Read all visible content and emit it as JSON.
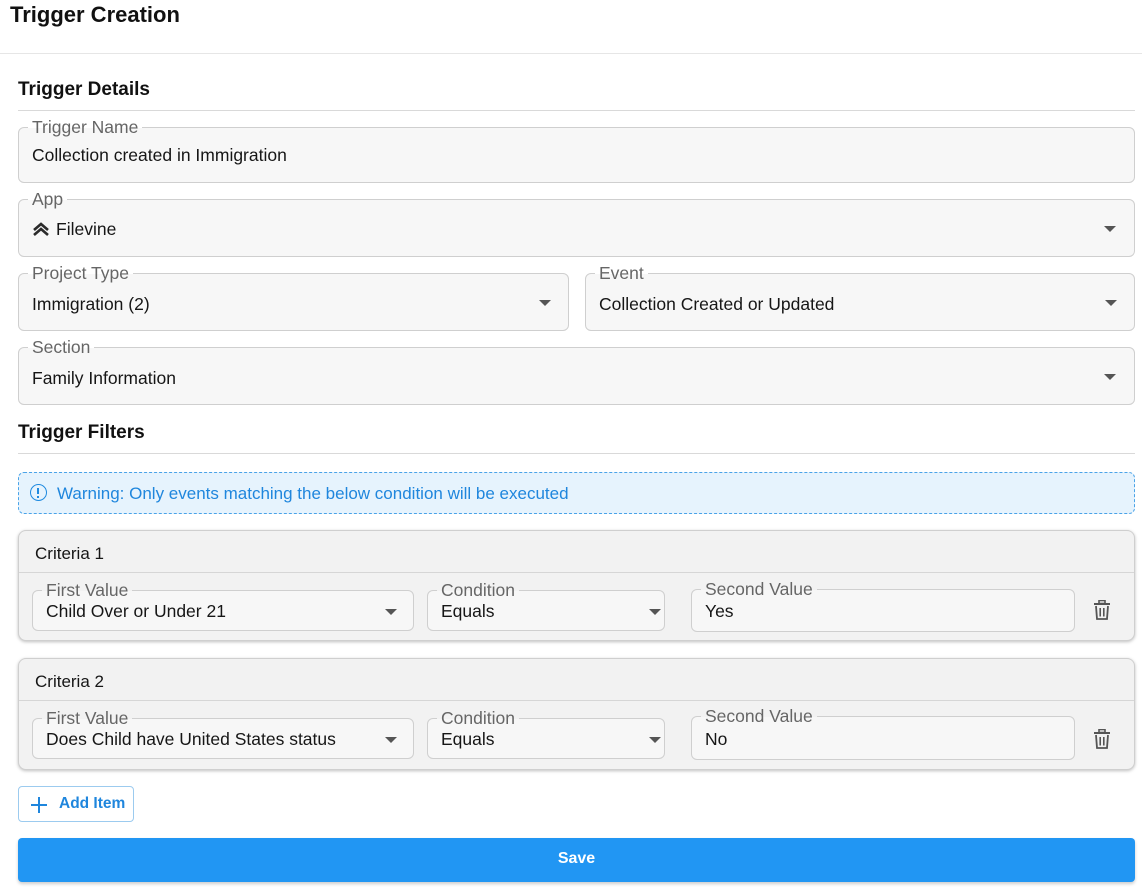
{
  "header": {
    "title": "Trigger Creation"
  },
  "details": {
    "title": "Trigger Details",
    "trigger_name": {
      "label": "Trigger Name",
      "value": "Collection created in Immigration"
    },
    "app": {
      "label": "App",
      "value": "Filevine",
      "icon": "filevine-logo-icon"
    },
    "project_type": {
      "label": "Project Type",
      "value": "Immigration (2)"
    },
    "event": {
      "label": "Event",
      "value": "Collection Created or Updated"
    },
    "section": {
      "label": "Section",
      "value": "Family Information"
    }
  },
  "filters": {
    "title": "Trigger Filters",
    "warning": {
      "text": "Warning: Only events matching the below condition will be executed",
      "icon": "info-icon",
      "color": "#1f86dd"
    },
    "criteria": [
      {
        "title": "Criteria 1",
        "first_value_label": "First Value",
        "first_value": "Child Over or Under 21",
        "condition_label": "Condition",
        "condition": "Equals",
        "second_value_label": "Second Value",
        "second_value": "Yes"
      },
      {
        "title": "Criteria 2",
        "first_value_label": "First Value",
        "first_value": "Does Child have United States status",
        "condition_label": "Condition",
        "condition": "Equals",
        "second_value_label": "Second Value",
        "second_value": "No"
      }
    ]
  },
  "actions": {
    "add_item_label": "Add Item",
    "save_label": "Save",
    "accent_color": "#2196f3"
  }
}
